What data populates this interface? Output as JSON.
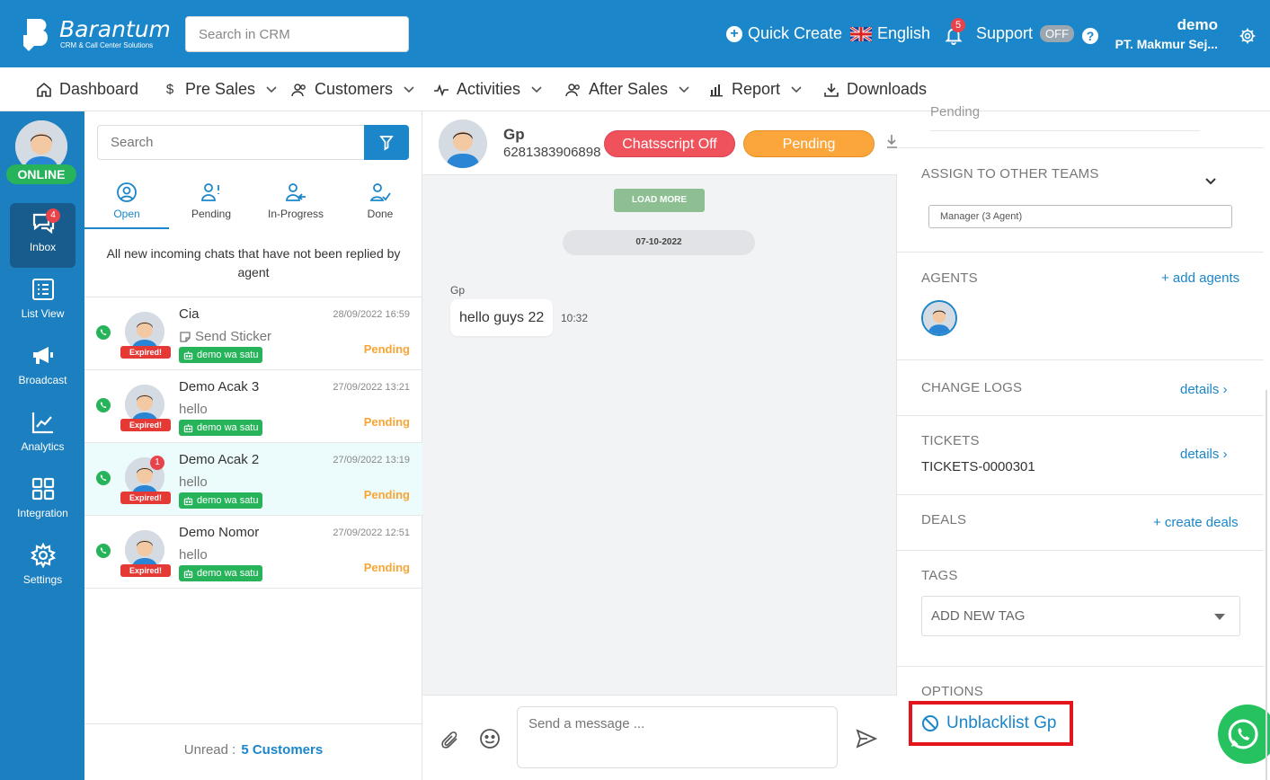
{
  "topbar": {
    "logo_text": "Barantum",
    "logo_sub": "CRM & Call Center Solutions",
    "search_placeholder": "Search in CRM",
    "quick_create": "Quick Create",
    "language": "English",
    "notification_count": "5",
    "support_label": "Support",
    "support_state": "OFF",
    "help_glyph": "?",
    "user_name": "demo",
    "user_company": "PT. Makmur Sej..."
  },
  "nav": {
    "items": [
      {
        "label": "Dashboard",
        "icon": "home-icon"
      },
      {
        "label": "Pre Sales",
        "icon": "dollar-icon"
      },
      {
        "label": "Customers",
        "icon": "users-icon"
      },
      {
        "label": "Activities",
        "icon": "pulse-icon"
      },
      {
        "label": "After Sales",
        "icon": "users-icon"
      },
      {
        "label": "Report",
        "icon": "bar-chart-icon"
      },
      {
        "label": "Downloads",
        "icon": "download-icon"
      }
    ]
  },
  "sidebar": {
    "status": "ONLINE",
    "items": [
      {
        "label": "Inbox",
        "badge": "4"
      },
      {
        "label": "List View"
      },
      {
        "label": "Broadcast"
      },
      {
        "label": "Analytics"
      },
      {
        "label": "Integration"
      },
      {
        "label": "Settings"
      }
    ]
  },
  "chat_list": {
    "search_placeholder": "Search",
    "tabs": [
      {
        "label": "Open"
      },
      {
        "label": "Pending"
      },
      {
        "label": "In-Progress"
      },
      {
        "label": "Done"
      }
    ],
    "tab_description": "All new incoming chats that have not been replied by agent",
    "expired_label": "Expired!",
    "rows": [
      {
        "name": "Cia",
        "time": "28/09/2022 16:59",
        "message": "Send Sticker",
        "channel": "demo wa satu",
        "status": "Pending"
      },
      {
        "name": "Demo Acak 3",
        "time": "27/09/2022 13:21",
        "message": "hello",
        "channel": "demo wa satu",
        "status": "Pending"
      },
      {
        "name": "Demo Acak 2",
        "time": "27/09/2022 13:19",
        "message": "hello",
        "channel": "demo wa satu",
        "status": "Pending",
        "unread": "1"
      },
      {
        "name": "Demo Nomor",
        "time": "27/09/2022 12:51",
        "message": "hello",
        "channel": "demo wa satu",
        "status": "Pending"
      }
    ],
    "footer_label": "Unread :",
    "footer_count": "5 Customers"
  },
  "chat": {
    "contact_name": "Gp",
    "contact_phone": "6281383906898",
    "chatscript_button": "Chatsscript Off",
    "status_button": "Pending",
    "load_more": "LOAD MORE",
    "date": "07-10-2022",
    "message_sender": "Gp",
    "message_text": "hello guys 22",
    "message_time": "10:32",
    "input_placeholder": "Send a message ..."
  },
  "details": {
    "assign_title": "ASSIGN TO OTHER TEAMS",
    "team_value": "Manager (3 Agent)",
    "agents_title": "AGENTS",
    "add_agents": "+ add agents",
    "changelogs_title": "CHANGE LOGS",
    "changelogs_link": "details",
    "tickets_title": "TICKETS",
    "tickets_link": "details",
    "ticket_id": "TICKETS-0000301",
    "deals_title": "DEALS",
    "create_deals": "+ create deals",
    "tags_title": "TAGS",
    "tag_placeholder": "ADD NEW TAG",
    "options_title": "OPTIONS",
    "unblacklist": "Unblacklist Gp"
  },
  "colors": {
    "brand": "#1b86c9",
    "online": "#27b35a",
    "pending": "#f7a535",
    "danger": "#e53935",
    "highlight": "#e3141c"
  }
}
